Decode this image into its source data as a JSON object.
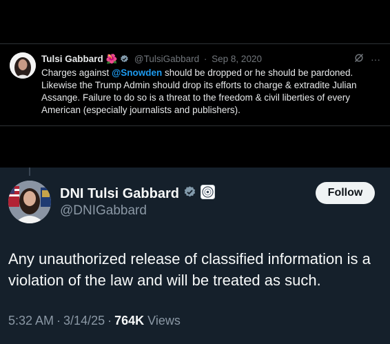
{
  "quoted_tweet": {
    "author_name": "Tulsi Gabbard",
    "flower_emoji": "🌺",
    "handle": "@TulsiGabbard",
    "separator": "·",
    "date": "Sep 8, 2020",
    "more_glyph": "···",
    "text_before_mention": "Charges against ",
    "mention": "@Snowden",
    "text_after_mention": " should be dropped or he should be pardoned. Likewise the Trump Admin  should drop its efforts to charge & extradite Julian Assange. Failure to do so is a threat to the freedom & civil liberties of every American (especially journalists and publishers)."
  },
  "main_tweet": {
    "author_name": "DNI Tulsi Gabbard",
    "handle": "@DNIGabbard",
    "follow_label": "Follow",
    "text": "Any unauthorized release of classified information is a violation of the law and will be treated as such.",
    "time": "5:32 AM",
    "date": "3/14/25",
    "separator": "·",
    "views_count": "764K",
    "views_label": " Views"
  },
  "colors": {
    "accent": "#1d9bf0",
    "card_bg": "#15202b",
    "verified": "#829aab"
  }
}
